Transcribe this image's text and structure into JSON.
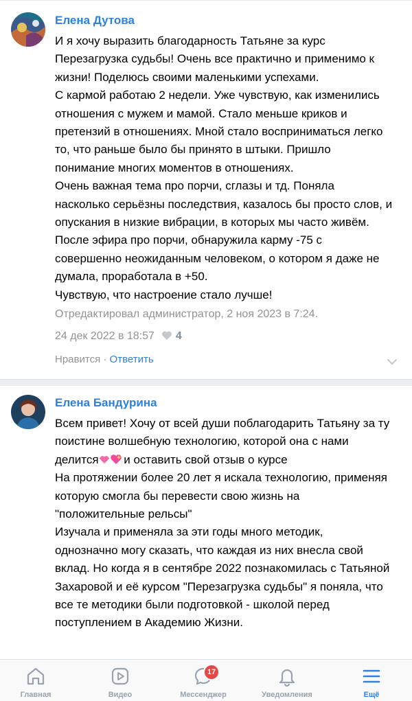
{
  "comments": [
    {
      "author": "Елена Дутова",
      "lines": [
        "И я хочу выразить благодарность Татьяне за курс",
        "Перезагрузка судьбы! Очень все практично и применимо к",
        "жизни! Поделюсь своими маленькими успехами.",
        "С кармой работаю 2 недели. Уже чувствую, как изменились",
        "отношения с мужем и мамой. Стало меньше криков и",
        "претензий в отношениях. Мной стало восприниматься легко",
        "то, что раньше было бы принято в штыки. Пришло",
        "понимание многих моментов в отношениях.",
        "Очень важная тема про порчи, сглазы и тд. Поняла",
        "насколько серьёзны последствия, казалось бы просто слов, и",
        "опускания в низкие вибрации, в которых мы часто живём.",
        "После эфира про порчи, обнаружила карму -75 с",
        "совершенно неожиданным человеком, о котором я даже не",
        "думала, проработала в +50.",
        "Чувствую, что настроение стало лучше!"
      ],
      "edited": "Отредактировал администратор, 2 ноя 2023 в 7:24.",
      "date": "24 дек 2022 в 18:57",
      "likes": "4",
      "like_label": "Нравится",
      "separator": " · ",
      "reply_label": "Ответить"
    },
    {
      "author": "Елена Бандурина",
      "lines": [
        "Всем привет! Хочу от всей души поблагодарить Татьяну за ту",
        "поистине волшебную технологию, которой она с нами",
        "делится",
        "На протяжении более 20 лет я искала технологию, применяя",
        "которую смогла бы перевести свою жизнь на",
        "\"положительные рельсы\"",
        "Изучала и применяла за эти годы много методик,",
        "однозначно могу сказать, что каждая из них внесла свой",
        "вклад. Но когда я в сентябре 2022 познакомилась с Татьяной",
        "Захаровой и её курсом \"Перезагрузка судьбы\" я поняла, что",
        "все те методики были подготовкой - школой перед",
        "поступлением в Академию Жизни."
      ],
      "line3_suffix": " и оставить свой отзыв о курсе"
    }
  ],
  "tabbar": {
    "tabs": [
      {
        "label": "Главная",
        "icon": "home-icon"
      },
      {
        "label": "Видео",
        "icon": "video-icon"
      },
      {
        "label": "Мессенджер",
        "icon": "messenger-icon"
      },
      {
        "label": "Уведомления",
        "icon": "bell-icon"
      },
      {
        "label": "Ещё",
        "icon": "menu-icon"
      }
    ],
    "messenger_badge": "17",
    "active_index": 4
  },
  "colors": {
    "link": "#2d81e0",
    "secondary": "#939393",
    "tab_inactive": "#99a2ad",
    "badge": "#e64646"
  }
}
